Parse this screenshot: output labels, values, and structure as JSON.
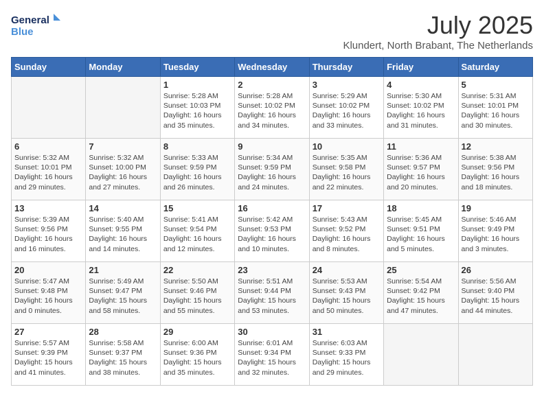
{
  "header": {
    "logo_line1": "General",
    "logo_line2": "Blue",
    "month_year": "July 2025",
    "location": "Klundert, North Brabant, The Netherlands"
  },
  "weekdays": [
    "Sunday",
    "Monday",
    "Tuesday",
    "Wednesday",
    "Thursday",
    "Friday",
    "Saturday"
  ],
  "weeks": [
    [
      {
        "day": "",
        "info": ""
      },
      {
        "day": "",
        "info": ""
      },
      {
        "day": "1",
        "info": "Sunrise: 5:28 AM\nSunset: 10:03 PM\nDaylight: 16 hours\nand 35 minutes."
      },
      {
        "day": "2",
        "info": "Sunrise: 5:28 AM\nSunset: 10:02 PM\nDaylight: 16 hours\nand 34 minutes."
      },
      {
        "day": "3",
        "info": "Sunrise: 5:29 AM\nSunset: 10:02 PM\nDaylight: 16 hours\nand 33 minutes."
      },
      {
        "day": "4",
        "info": "Sunrise: 5:30 AM\nSunset: 10:02 PM\nDaylight: 16 hours\nand 31 minutes."
      },
      {
        "day": "5",
        "info": "Sunrise: 5:31 AM\nSunset: 10:01 PM\nDaylight: 16 hours\nand 30 minutes."
      }
    ],
    [
      {
        "day": "6",
        "info": "Sunrise: 5:32 AM\nSunset: 10:01 PM\nDaylight: 16 hours\nand 29 minutes."
      },
      {
        "day": "7",
        "info": "Sunrise: 5:32 AM\nSunset: 10:00 PM\nDaylight: 16 hours\nand 27 minutes."
      },
      {
        "day": "8",
        "info": "Sunrise: 5:33 AM\nSunset: 9:59 PM\nDaylight: 16 hours\nand 26 minutes."
      },
      {
        "day": "9",
        "info": "Sunrise: 5:34 AM\nSunset: 9:59 PM\nDaylight: 16 hours\nand 24 minutes."
      },
      {
        "day": "10",
        "info": "Sunrise: 5:35 AM\nSunset: 9:58 PM\nDaylight: 16 hours\nand 22 minutes."
      },
      {
        "day": "11",
        "info": "Sunrise: 5:36 AM\nSunset: 9:57 PM\nDaylight: 16 hours\nand 20 minutes."
      },
      {
        "day": "12",
        "info": "Sunrise: 5:38 AM\nSunset: 9:56 PM\nDaylight: 16 hours\nand 18 minutes."
      }
    ],
    [
      {
        "day": "13",
        "info": "Sunrise: 5:39 AM\nSunset: 9:56 PM\nDaylight: 16 hours\nand 16 minutes."
      },
      {
        "day": "14",
        "info": "Sunrise: 5:40 AM\nSunset: 9:55 PM\nDaylight: 16 hours\nand 14 minutes."
      },
      {
        "day": "15",
        "info": "Sunrise: 5:41 AM\nSunset: 9:54 PM\nDaylight: 16 hours\nand 12 minutes."
      },
      {
        "day": "16",
        "info": "Sunrise: 5:42 AM\nSunset: 9:53 PM\nDaylight: 16 hours\nand 10 minutes."
      },
      {
        "day": "17",
        "info": "Sunrise: 5:43 AM\nSunset: 9:52 PM\nDaylight: 16 hours\nand 8 minutes."
      },
      {
        "day": "18",
        "info": "Sunrise: 5:45 AM\nSunset: 9:51 PM\nDaylight: 16 hours\nand 5 minutes."
      },
      {
        "day": "19",
        "info": "Sunrise: 5:46 AM\nSunset: 9:49 PM\nDaylight: 16 hours\nand 3 minutes."
      }
    ],
    [
      {
        "day": "20",
        "info": "Sunrise: 5:47 AM\nSunset: 9:48 PM\nDaylight: 16 hours\nand 0 minutes."
      },
      {
        "day": "21",
        "info": "Sunrise: 5:49 AM\nSunset: 9:47 PM\nDaylight: 15 hours\nand 58 minutes."
      },
      {
        "day": "22",
        "info": "Sunrise: 5:50 AM\nSunset: 9:46 PM\nDaylight: 15 hours\nand 55 minutes."
      },
      {
        "day": "23",
        "info": "Sunrise: 5:51 AM\nSunset: 9:44 PM\nDaylight: 15 hours\nand 53 minutes."
      },
      {
        "day": "24",
        "info": "Sunrise: 5:53 AM\nSunset: 9:43 PM\nDaylight: 15 hours\nand 50 minutes."
      },
      {
        "day": "25",
        "info": "Sunrise: 5:54 AM\nSunset: 9:42 PM\nDaylight: 15 hours\nand 47 minutes."
      },
      {
        "day": "26",
        "info": "Sunrise: 5:56 AM\nSunset: 9:40 PM\nDaylight: 15 hours\nand 44 minutes."
      }
    ],
    [
      {
        "day": "27",
        "info": "Sunrise: 5:57 AM\nSunset: 9:39 PM\nDaylight: 15 hours\nand 41 minutes."
      },
      {
        "day": "28",
        "info": "Sunrise: 5:58 AM\nSunset: 9:37 PM\nDaylight: 15 hours\nand 38 minutes."
      },
      {
        "day": "29",
        "info": "Sunrise: 6:00 AM\nSunset: 9:36 PM\nDaylight: 15 hours\nand 35 minutes."
      },
      {
        "day": "30",
        "info": "Sunrise: 6:01 AM\nSunset: 9:34 PM\nDaylight: 15 hours\nand 32 minutes."
      },
      {
        "day": "31",
        "info": "Sunrise: 6:03 AM\nSunset: 9:33 PM\nDaylight: 15 hours\nand 29 minutes."
      },
      {
        "day": "",
        "info": ""
      },
      {
        "day": "",
        "info": ""
      }
    ]
  ]
}
